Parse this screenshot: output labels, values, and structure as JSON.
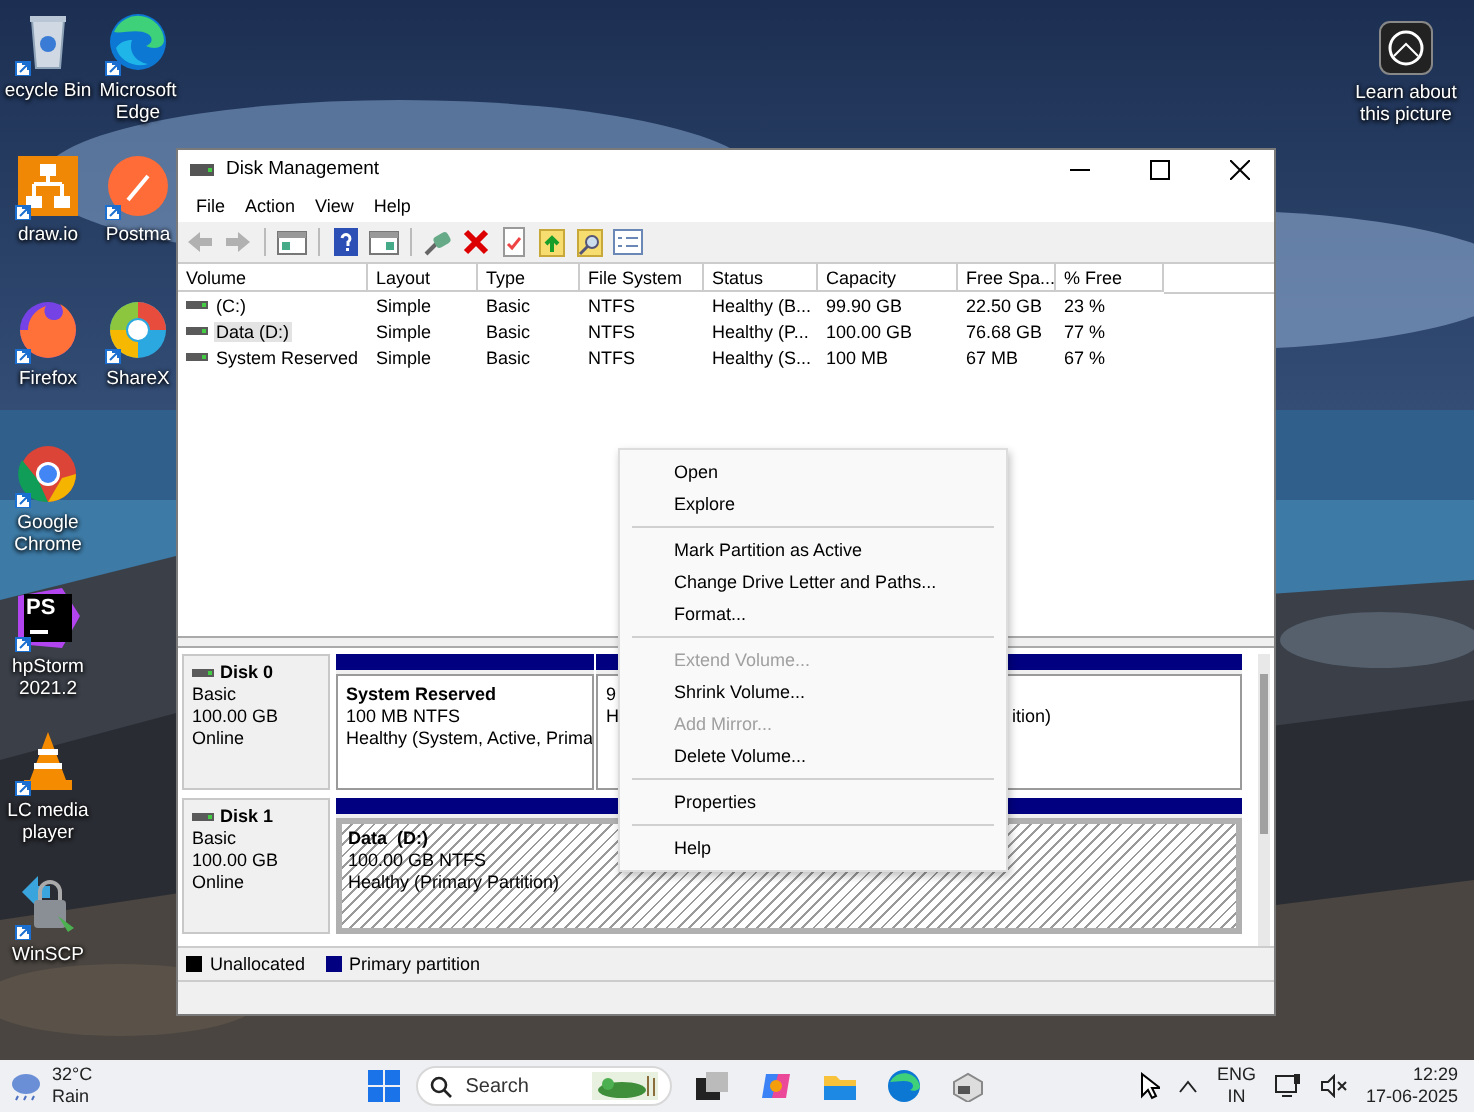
{
  "desktop_columns": [
    [
      {
        "label": "ecycle Bin",
        "kind": "bin"
      },
      {
        "label": "draw.io",
        "kind": "drawio"
      },
      {
        "label": "Firefox",
        "kind": "firefox"
      },
      {
        "label": "Google Chrome",
        "kind": "chrome"
      },
      {
        "label": "hpStorm 2021.2",
        "kind": "phpstorm",
        "glyph": "PS"
      },
      {
        "label": "LC media player",
        "kind": "vlc"
      },
      {
        "label": "WinSCP",
        "kind": "winscp"
      }
    ],
    [
      {
        "label": "Microsoft Edge",
        "kind": "edge"
      },
      {
        "label": "Postma",
        "kind": "postman"
      },
      {
        "label": "ShareX",
        "kind": "sharex"
      }
    ]
  ],
  "learn_icon": {
    "label": "Learn about this picture"
  },
  "window": {
    "title": "Disk Management",
    "menu": [
      "File",
      "Action",
      "View",
      "Help"
    ],
    "toolbar": [
      {
        "kind": "back",
        "disabled": true
      },
      {
        "kind": "forward",
        "disabled": true
      },
      {
        "kind": "separator"
      },
      {
        "kind": "console",
        "disabled": false
      },
      {
        "kind": "separator"
      },
      {
        "kind": "help",
        "disabled": false
      },
      {
        "kind": "pane",
        "disabled": false
      },
      {
        "kind": "separator"
      },
      {
        "kind": "connect",
        "disabled": false
      },
      {
        "kind": "delete",
        "disabled": false
      },
      {
        "kind": "check",
        "disabled": false
      },
      {
        "kind": "folder-up",
        "disabled": false
      },
      {
        "kind": "folder-search",
        "disabled": false
      },
      {
        "kind": "list",
        "disabled": false
      }
    ]
  },
  "volumes": {
    "columns": [
      "Volume",
      "Layout",
      "Type",
      "File System",
      "Status",
      "Capacity",
      "Free Spa...",
      "% Free"
    ],
    "rows": [
      {
        "cells": [
          "(C:)",
          "Simple",
          "Basic",
          "NTFS",
          "Healthy (B...",
          "99.90 GB",
          "22.50 GB",
          "23 %"
        ],
        "selected": false
      },
      {
        "cells": [
          "Data (D:)",
          "Simple",
          "Basic",
          "NTFS",
          "Healthy (P...",
          "100.00 GB",
          "76.68 GB",
          "77 %"
        ],
        "selected": true
      },
      {
        "cells": [
          "System Reserved",
          "Simple",
          "Basic",
          "NTFS",
          "Healthy (S...",
          "100 MB",
          "67 MB",
          "67 %"
        ],
        "selected": false
      }
    ]
  },
  "disks": [
    {
      "name": "Disk 0",
      "type": "Basic",
      "size": "100.00 GB",
      "status": "Online",
      "partitions": [
        {
          "title": "System Reserved",
          "lines": [
            "100 MB NTFS",
            "Healthy (System, Active, Prima"
          ],
          "selected": false
        },
        {
          "lines": [
            "9",
            "H"
          ],
          "tail": "ition)",
          "selected": false
        }
      ]
    },
    {
      "name": "Disk 1",
      "type": "Basic",
      "size": "100.00 GB",
      "status": "Online",
      "partitions": [
        {
          "title": "Data  (D:)",
          "lines": [
            "100.00 GB NTFS",
            "Healthy (Primary Partition)"
          ],
          "selected": true
        }
      ]
    }
  ],
  "legend": [
    {
      "label": "Unallocated",
      "color": "#000000"
    },
    {
      "label": "Primary partition",
      "color": "#000080"
    }
  ],
  "context_menu": [
    {
      "kind": "item",
      "label": "Open",
      "disabled": false
    },
    {
      "kind": "item",
      "label": "Explore",
      "disabled": false
    },
    {
      "kind": "separator"
    },
    {
      "kind": "item",
      "label": "Mark Partition as Active",
      "disabled": false
    },
    {
      "kind": "item",
      "label": "Change Drive Letter and Paths...",
      "disabled": false
    },
    {
      "kind": "item",
      "label": "Format...",
      "disabled": false
    },
    {
      "kind": "separator"
    },
    {
      "kind": "item",
      "label": "Extend Volume...",
      "disabled": true
    },
    {
      "kind": "item",
      "label": "Shrink Volume...",
      "disabled": false
    },
    {
      "kind": "item",
      "label": "Add Mirror...",
      "disabled": true
    },
    {
      "kind": "item",
      "label": "Delete Volume...",
      "disabled": false
    },
    {
      "kind": "separator"
    },
    {
      "kind": "item",
      "label": "Properties",
      "disabled": false
    },
    {
      "kind": "separator"
    },
    {
      "kind": "item",
      "label": "Help",
      "disabled": false
    }
  ],
  "taskbar": {
    "weather": {
      "temp": "32°C",
      "condition": "Rain"
    },
    "search": {
      "placeholder": "Search"
    },
    "apps": [
      {
        "kind": "task-view"
      },
      {
        "kind": "copilot"
      },
      {
        "kind": "explorer"
      },
      {
        "kind": "edge"
      },
      {
        "kind": "app"
      }
    ],
    "language": [
      "ENG",
      "IN"
    ],
    "time": "12:29",
    "date": "17-06-2025"
  }
}
